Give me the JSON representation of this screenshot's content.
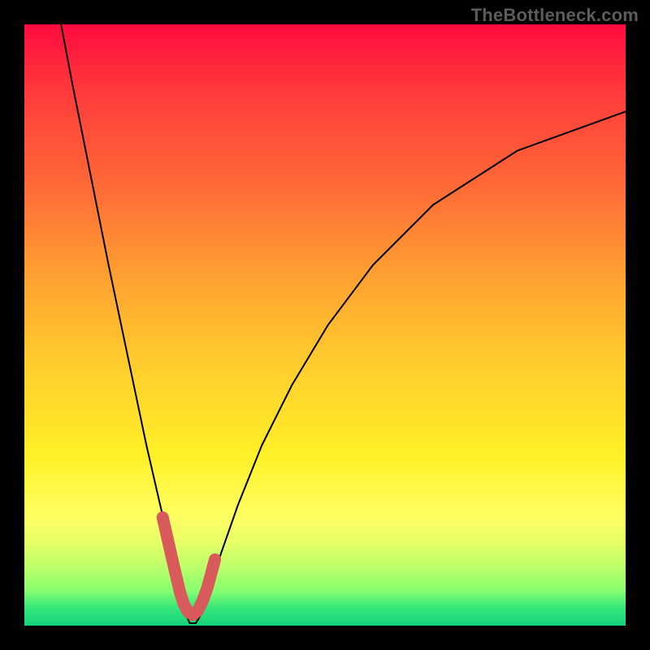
{
  "watermark": "TheBottleneck.com",
  "chart_data": {
    "type": "line",
    "title": "",
    "xlabel": "",
    "ylabel": "",
    "xlim": [
      0,
      100
    ],
    "ylim": [
      0,
      100
    ],
    "minimum_x": 27,
    "series": [
      {
        "name": "bottleneck-curve",
        "points": [
          {
            "x": 6.1,
            "y": 100.0
          },
          {
            "x": 8.0,
            "y": 90.0
          },
          {
            "x": 10.0,
            "y": 80.0
          },
          {
            "x": 12.0,
            "y": 70.0
          },
          {
            "x": 14.0,
            "y": 60.0
          },
          {
            "x": 16.1,
            "y": 50.0
          },
          {
            "x": 18.2,
            "y": 40.0
          },
          {
            "x": 20.3,
            "y": 30.0
          },
          {
            "x": 22.6,
            "y": 20.0
          },
          {
            "x": 25.0,
            "y": 10.0
          },
          {
            "x": 25.8,
            "y": 6.0
          },
          {
            "x": 26.8,
            "y": 2.0
          },
          {
            "x": 27.5,
            "y": 0.4
          },
          {
            "x": 28.5,
            "y": 0.4
          },
          {
            "x": 29.5,
            "y": 2.0
          },
          {
            "x": 30.5,
            "y": 5.0
          },
          {
            "x": 32.0,
            "y": 10.0
          },
          {
            "x": 35.5,
            "y": 20.0
          },
          {
            "x": 39.5,
            "y": 30.0
          },
          {
            "x": 44.5,
            "y": 40.0
          },
          {
            "x": 50.5,
            "y": 50.0
          },
          {
            "x": 58.0,
            "y": 60.0
          },
          {
            "x": 68.0,
            "y": 70.0
          },
          {
            "x": 82.0,
            "y": 79.0
          },
          {
            "x": 100.0,
            "y": 85.5
          }
        ]
      },
      {
        "name": "highlight-band",
        "x_range": [
          23.0,
          31.7
        ],
        "points": [
          {
            "x": 23.0,
            "y": 18.0
          },
          {
            "x": 23.8,
            "y": 14.5
          },
          {
            "x": 24.6,
            "y": 11.0
          },
          {
            "x": 25.3,
            "y": 8.0
          },
          {
            "x": 25.9,
            "y": 5.5
          },
          {
            "x": 26.5,
            "y": 3.6
          },
          {
            "x": 27.2,
            "y": 2.3
          },
          {
            "x": 28.0,
            "y": 1.8
          },
          {
            "x": 28.8,
            "y": 2.4
          },
          {
            "x": 29.6,
            "y": 4.0
          },
          {
            "x": 30.4,
            "y": 6.2
          },
          {
            "x": 31.0,
            "y": 8.4
          },
          {
            "x": 31.7,
            "y": 11.0
          }
        ]
      }
    ],
    "colors": {
      "curve": "#000000",
      "highlight": "#d85a5a"
    }
  }
}
